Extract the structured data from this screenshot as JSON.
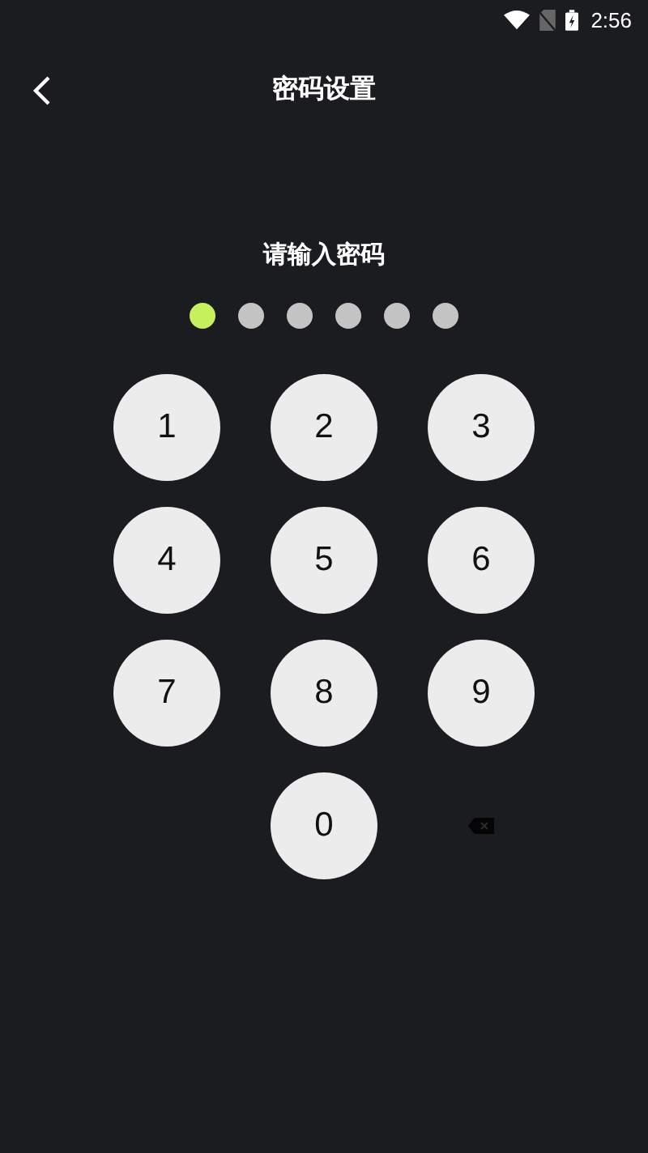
{
  "status_bar": {
    "time": "2:56"
  },
  "header": {
    "title": "密码设置"
  },
  "prompt": "请输入密码",
  "dots": [
    {
      "filled": true
    },
    {
      "filled": false
    },
    {
      "filled": false
    },
    {
      "filled": false
    },
    {
      "filled": false
    },
    {
      "filled": false
    }
  ],
  "keypad": [
    {
      "kind": "digit",
      "label": "1"
    },
    {
      "kind": "digit",
      "label": "2"
    },
    {
      "kind": "digit",
      "label": "3"
    },
    {
      "kind": "digit",
      "label": "4"
    },
    {
      "kind": "digit",
      "label": "5"
    },
    {
      "kind": "digit",
      "label": "6"
    },
    {
      "kind": "digit",
      "label": "7"
    },
    {
      "kind": "digit",
      "label": "8"
    },
    {
      "kind": "digit",
      "label": "9"
    },
    {
      "kind": "empty"
    },
    {
      "kind": "digit",
      "label": "0"
    },
    {
      "kind": "backspace"
    }
  ]
}
